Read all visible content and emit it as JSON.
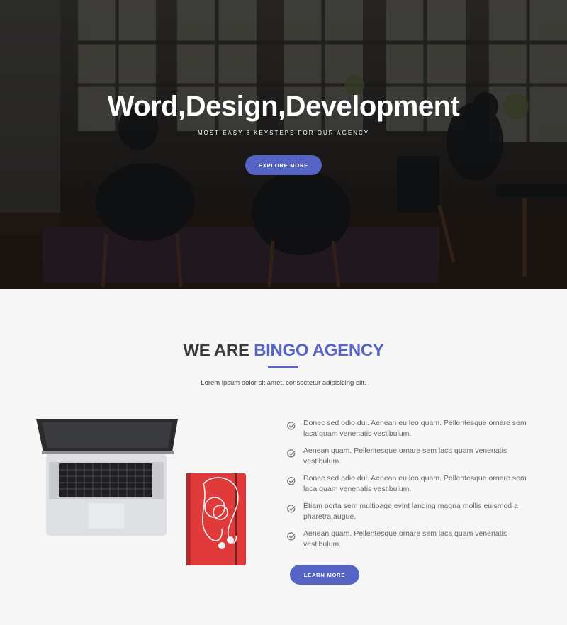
{
  "hero": {
    "title": "Word,Design,Development",
    "subtitle": "MOST EASY 3 KEYSTEPS FOR OUR AGENCY",
    "button_label": "EXPLORE MORE"
  },
  "about": {
    "title_prefix": "WE ARE",
    "title_accent": "BINGO AGENCY",
    "lead": "Lorem ipsum dolor sit amet, consectetur adipisicing elit.",
    "features": [
      "Donec sed odio dui. Aenean eu leo quam. Pellentesque ornare sem laca quam venenatis vestibulum.",
      "Aenean quam. Pellentesque ornare sem laca quam venenatis vestibulum.",
      "Donec sed odio dui. Aenean eu leo quam. Pellentesque ornare sem laca quam venenatis vestibulum.",
      "Etiam porta sem multipage evint landing magna mollis euismod a pharetra augue.",
      "Aenean quam. Pellentesque ornare sem laca quam venenatis vestibulum."
    ],
    "button_label": "LEARN MORE"
  },
  "colors": {
    "accent": "#5564c5",
    "heading": "#3b3b3b",
    "background": "#f6f6f6"
  },
  "icons": {
    "feature_bullet": "check-circle-icon"
  }
}
